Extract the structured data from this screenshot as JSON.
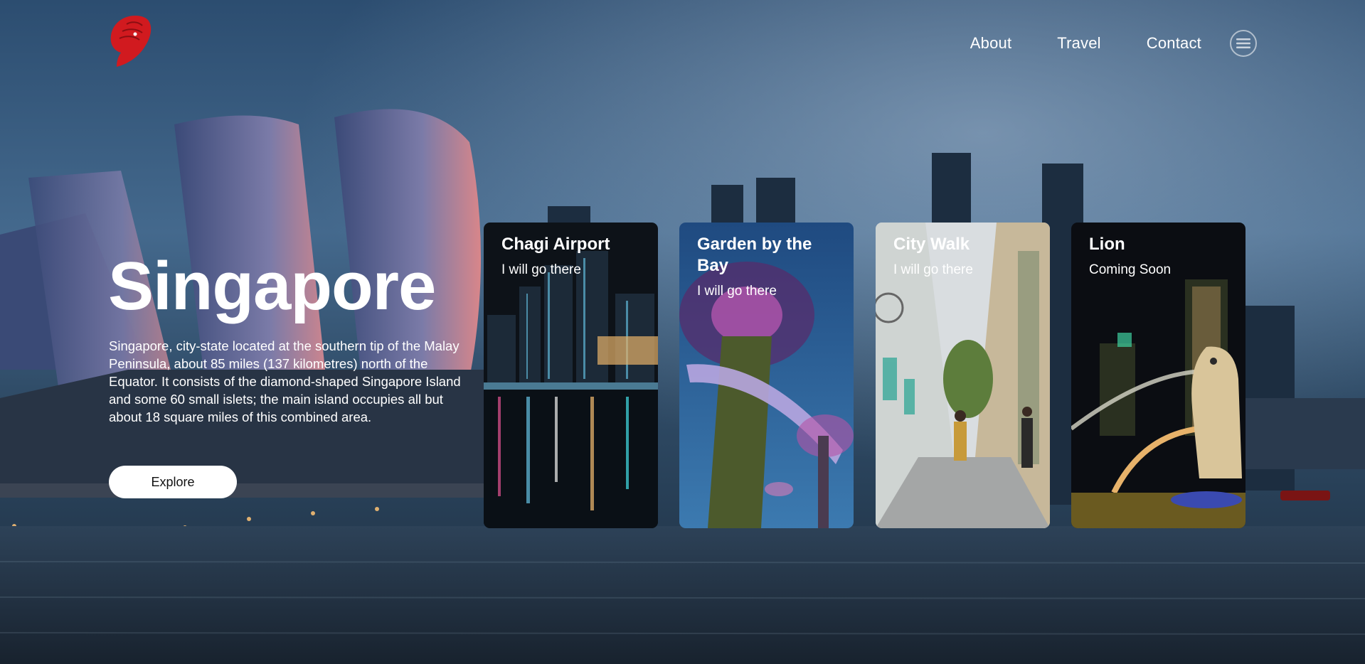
{
  "nav": {
    "items": [
      "About",
      "Travel",
      "Contact"
    ]
  },
  "icons": {
    "logo": "merlion-logo",
    "menu": "hamburger-circle-icon"
  },
  "hero": {
    "title": "Singapore",
    "description": "Singapore, city-state located at the southern tip of the Malay Peninsula, about 85 miles (137 kilometres) north of the Equator. It consists of the diamond-shaped Singapore Island and some 60 small islets; the main island occupies all but about 18 square miles of this combined area.",
    "button": "Explore"
  },
  "cards": [
    {
      "title": "Chagi Airport",
      "subtitle": "I will go there"
    },
    {
      "title": "Garden by the Bay",
      "subtitle": "I will go there"
    },
    {
      "title": "City Walk",
      "subtitle": "I will go there"
    },
    {
      "title": "Lion",
      "subtitle": "Coming Soon"
    }
  ],
  "colors": {
    "logo_red": "#d11a1f",
    "sky_dark": "#1b3552",
    "water": "#233446",
    "button_bg": "#ffffff"
  }
}
